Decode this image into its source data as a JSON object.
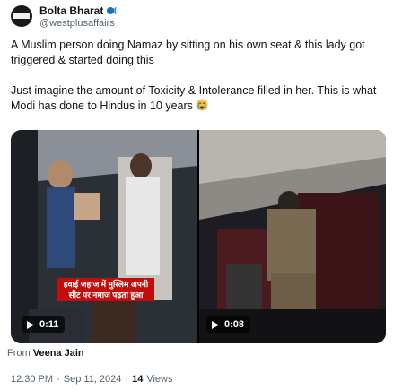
{
  "author": {
    "display_name": "Bolta Bharat",
    "name_emoji": "speaking-head-icon",
    "handle": "@westplusaffairs",
    "avatar_text": "Bolta Bharat"
  },
  "tweet": {
    "paragraph1": "A Muslim person doing Namaz by sitting on his own seat & this lady got triggered & started doing this",
    "paragraph2": "Just imagine the amount of Toxicity & Intolerance filled in her. This is what Modi has done to Hindus in 10 years",
    "paragraph2_emoji": "crying-face-icon"
  },
  "media": [
    {
      "duration": "0:11",
      "caption": "हवाई जहाज में मुस्लिम अपनी सीट पर नमाज पढ़ता हुआ"
    },
    {
      "duration": "0:08"
    }
  ],
  "source": {
    "prefix": "From",
    "name": "Veena Jain"
  },
  "meta": {
    "time": "12:30 PM",
    "separator": "·",
    "date": "Sep 11, 2024",
    "views_count": "14",
    "views_label": "Views"
  },
  "colors": {
    "text_primary": "#0f1419",
    "text_secondary": "#536471",
    "caption_red": "#c20d0d"
  }
}
